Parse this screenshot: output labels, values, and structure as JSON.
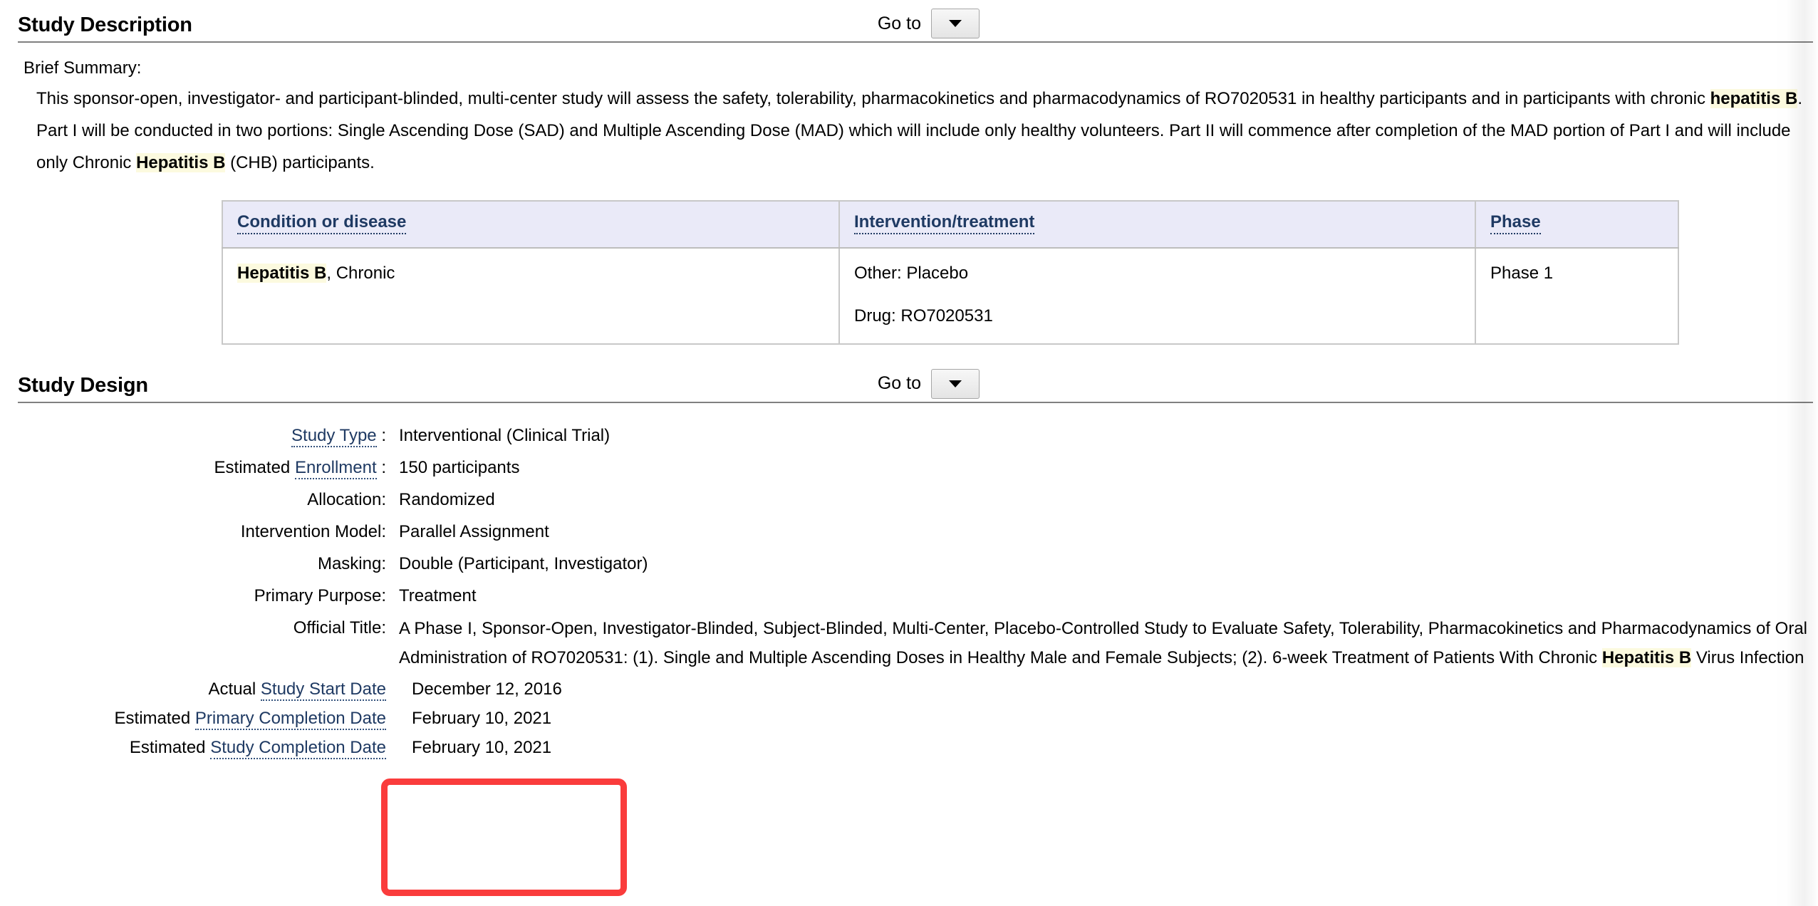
{
  "sections": {
    "study_description": {
      "title": "Study Description",
      "goto_label": "Go to",
      "goto_icon": "chevron-down-icon",
      "brief_label": "Brief Summary:",
      "brief_summary_parts": [
        {
          "t": "This sponsor-open, investigator- and participant-blinded, multi-center study will assess the safety, tolerability, pharmacokinetics and pharmacodynamics of RO7020531 in healthy participants and in participants with chronic ",
          "hl": false
        },
        {
          "t": "hepatitis B",
          "hl": true
        },
        {
          "t": ". Part I will be conducted in two portions: Single Ascending Dose (SAD) and Multiple Ascending Dose (MAD) which will include only healthy volunteers. Part II will commence after completion of the MAD portion of Part I and will include only Chronic ",
          "hl": false
        },
        {
          "t": "Hepatitis B",
          "hl": true
        },
        {
          "t": " (CHB) participants.",
          "hl": false
        }
      ],
      "table": {
        "columns": [
          "Condition or disease",
          "Intervention/treatment",
          "Phase"
        ],
        "rows": [
          {
            "condition_parts": [
              {
                "t": "Hepatitis B",
                "hl": true
              },
              {
                "t": ", Chronic",
                "hl": false
              }
            ],
            "interventions": [
              "Other: Placebo",
              "Drug: RO7020531"
            ],
            "phase": "Phase 1"
          }
        ]
      }
    },
    "study_design": {
      "title": "Study Design",
      "goto_label": "Go to",
      "goto_icon": "chevron-down-icon",
      "rows": [
        {
          "prefix": "",
          "link": "Study Type",
          "suffix": " :",
          "value": "Interventional  (Clinical Trial)"
        },
        {
          "prefix": "Estimated ",
          "link": "Enrollment",
          "suffix": " :",
          "value": "150 participants"
        },
        {
          "prefix": "Allocation:",
          "link": "",
          "suffix": "",
          "value": "Randomized"
        },
        {
          "prefix": "Intervention Model:",
          "link": "",
          "suffix": "",
          "value": "Parallel Assignment"
        },
        {
          "prefix": "Masking:",
          "link": "",
          "suffix": "",
          "value": "Double (Participant, Investigator)"
        },
        {
          "prefix": "Primary Purpose:",
          "link": "",
          "suffix": "",
          "value": "Treatment"
        }
      ],
      "official_title_label": "Official Title:",
      "official_title_parts": [
        {
          "t": "A Phase I, Sponsor-Open, Investigator-Blinded, Subject-Blinded, Multi-Center, Placebo-Controlled Study to Evaluate Safety, Tolerability, Pharmacokinetics and Pharmacodynamics of Oral Administration of RO7020531: (1). Single and Multiple Ascending Doses in Healthy Male and Female Subjects; (2). 6-week Treatment of Patients With Chronic ",
          "hl": false
        },
        {
          "t": "Hepatitis B",
          "hl": true
        },
        {
          "t": " Virus Infection",
          "hl": false
        }
      ],
      "date_rows": [
        {
          "prefix": "Actual ",
          "link": "Study Start Date",
          "value": "December 12, 2016"
        },
        {
          "prefix": "Estimated ",
          "link": "Primary Completion Date",
          "value": "February 10, 2021"
        },
        {
          "prefix": "Estimated ",
          "link": "Study Completion Date",
          "value": "February 10, 2021"
        }
      ]
    }
  },
  "annotation": {
    "name": "red-highlight-box",
    "color": "#fa3c3c"
  },
  "colors": {
    "link": "#1f3a63",
    "table_header_bg": "#eaeaf8",
    "highlight_bg": "#fcfadf",
    "rule": "#808080"
  }
}
